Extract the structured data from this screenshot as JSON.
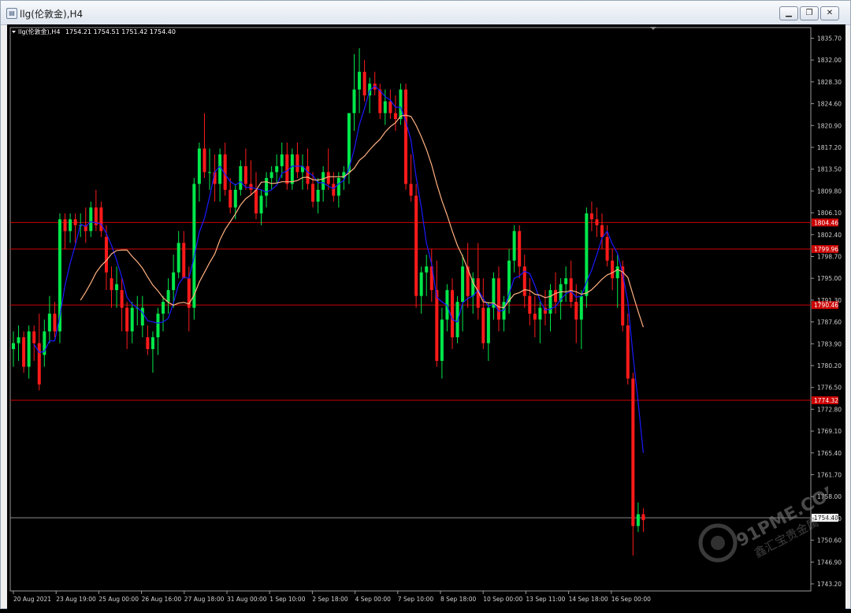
{
  "window": {
    "title": "llg(伦敦金),H4",
    "buttons": [
      "minimize",
      "restore",
      "close"
    ]
  },
  "chart_header": {
    "symbol": "llg(伦敦金),H4",
    "ohlc": "1754.21 1754.51 1751.42 1754.40"
  },
  "watermark": {
    "text_main": "91PME.COM",
    "text_sub": "鑫汇宝贵金属"
  },
  "colors": {
    "background": "#000000",
    "bull": "#00e84a",
    "bear": "#ff1a1a",
    "ma_fast": "#1a1aff",
    "ma_slow": "#ffb080",
    "level_line": "#cc0000",
    "current_line": "#8a8a8a"
  },
  "chart_data": {
    "type": "candlestick",
    "x_labels": [
      "20 Aug 2021",
      "23 Aug 19:00",
      "25 Aug 00:00",
      "26 Aug 16:00",
      "27 Aug 18:00",
      "31 Aug 00:00",
      "1 Sep 10:00",
      "2 Sep 18:00",
      "4 Sep 00:00",
      "7 Sep 10:00",
      "8 Sep 18:00",
      "10 Sep 00:00",
      "13 Sep 11:00",
      "14 Sep 18:00",
      "16 Sep 00:00"
    ],
    "x_label_candle_index": [
      0,
      7,
      14,
      21,
      28,
      35,
      42,
      49,
      56,
      63,
      70,
      77,
      84,
      91,
      98
    ],
    "y_ticks": [
      1835.7,
      1832.0,
      1828.3,
      1824.6,
      1820.9,
      1817.2,
      1813.5,
      1809.8,
      1806.1,
      1802.4,
      1798.7,
      1795.0,
      1791.3,
      1787.6,
      1783.9,
      1780.2,
      1776.5,
      1772.8,
      1769.1,
      1765.4,
      1761.7,
      1758.0,
      1754.3,
      1750.6,
      1746.9,
      1743.2
    ],
    "ylim": [
      1742.0,
      1837.5
    ],
    "horizontal_levels": [
      {
        "value": 1804.46,
        "label": "1804.46"
      },
      {
        "value": 1799.96,
        "label": "1799.96"
      },
      {
        "value": 1790.46,
        "label": "1790.46"
      },
      {
        "value": 1774.32,
        "label": "1774.32"
      }
    ],
    "current_price": {
      "value": 1754.4,
      "label": "1754.40"
    },
    "candles": [
      [
        1783,
        1786,
        1780,
        1784
      ],
      [
        1784,
        1787,
        1781,
        1785
      ],
      [
        1785,
        1786,
        1779,
        1780
      ],
      [
        1780,
        1787,
        1778,
        1786
      ],
      [
        1786,
        1787,
        1781,
        1784
      ],
      [
        1784,
        1789,
        1776,
        1777
      ],
      [
        1782,
        1788,
        1780,
        1786
      ],
      [
        1786,
        1792,
        1784,
        1789
      ],
      [
        1789,
        1791,
        1785,
        1786
      ],
      [
        1786,
        1806,
        1784,
        1805
      ],
      [
        1805,
        1806,
        1800,
        1803
      ],
      [
        1803,
        1806,
        1801,
        1805
      ],
      [
        1805,
        1806,
        1801,
        1804
      ],
      [
        1804,
        1806,
        1802,
        1804
      ],
      [
        1804,
        1807,
        1801,
        1803
      ],
      [
        1803,
        1808,
        1802,
        1807
      ],
      [
        1807,
        1810,
        1803,
        1804
      ],
      [
        1807,
        1808,
        1802,
        1803
      ],
      [
        1802,
        1804,
        1793,
        1796
      ],
      [
        1795,
        1797,
        1790,
        1793
      ],
      [
        1793,
        1797,
        1790,
        1794
      ],
      [
        1793,
        1795,
        1786,
        1790
      ],
      [
        1790,
        1791,
        1783,
        1786
      ],
      [
        1786,
        1791,
        1784,
        1790
      ],
      [
        1790,
        1792,
        1787,
        1790
      ],
      [
        1787,
        1792,
        1785,
        1790
      ],
      [
        1785,
        1787,
        1782,
        1783
      ],
      [
        1783,
        1786,
        1779,
        1785
      ],
      [
        1785,
        1790,
        1782,
        1789
      ],
      [
        1789,
        1792,
        1786,
        1791
      ],
      [
        1791,
        1795,
        1789,
        1793
      ],
      [
        1793,
        1799,
        1790,
        1796
      ],
      [
        1796,
        1803,
        1795,
        1801
      ],
      [
        1801,
        1803,
        1795,
        1795
      ],
      [
        1795,
        1797,
        1786,
        1790
      ],
      [
        1790,
        1812,
        1788,
        1811
      ],
      [
        1811,
        1818,
        1808,
        1817
      ],
      [
        1817,
        1823,
        1812,
        1813
      ],
      [
        1813,
        1817,
        1810,
        1813
      ],
      [
        1813,
        1816,
        1808,
        1811
      ],
      [
        1811,
        1817,
        1808,
        1816
      ],
      [
        1816,
        1818,
        1809,
        1810
      ],
      [
        1810,
        1812,
        1806,
        1807
      ],
      [
        1807,
        1811,
        1805,
        1810
      ],
      [
        1810,
        1815,
        1809,
        1814
      ],
      [
        1814,
        1817,
        1810,
        1811
      ],
      [
        1811,
        1815,
        1809,
        1810
      ],
      [
        1810,
        1813,
        1805,
        1806
      ],
      [
        1806,
        1810,
        1804,
        1809
      ],
      [
        1809,
        1813,
        1807,
        1812
      ],
      [
        1812,
        1814,
        1810,
        1813
      ],
      [
        1813,
        1816,
        1811,
        1814
      ],
      [
        1814,
        1818,
        1812,
        1816
      ],
      [
        1816,
        1818,
        1810,
        1811
      ],
      [
        1811,
        1817,
        1810,
        1816
      ],
      [
        1816,
        1818,
        1812,
        1813
      ],
      [
        1813,
        1816,
        1810,
        1814
      ],
      [
        1814,
        1817,
        1810,
        1811
      ],
      [
        1811,
        1813,
        1807,
        1808
      ],
      [
        1808,
        1812,
        1806,
        1810
      ],
      [
        1810,
        1814,
        1808,
        1813
      ],
      [
        1813,
        1817,
        1810,
        1811
      ],
      [
        1811,
        1813,
        1808,
        1809
      ],
      [
        1809,
        1813,
        1807,
        1812
      ],
      [
        1812,
        1814,
        1810,
        1813
      ],
      [
        1813,
        1823,
        1811,
        1823
      ],
      [
        1823,
        1833,
        1820,
        1827
      ],
      [
        1827,
        1834,
        1823,
        1830
      ],
      [
        1830,
        1832,
        1825,
        1826
      ],
      [
        1826,
        1829,
        1823,
        1828
      ],
      [
        1828,
        1830,
        1826,
        1827
      ],
      [
        1827,
        1828,
        1822,
        1823
      ],
      [
        1823,
        1827,
        1821,
        1825
      ],
      [
        1825,
        1827,
        1822,
        1823
      ],
      [
        1823,
        1826,
        1820,
        1822
      ],
      [
        1822,
        1828,
        1821,
        1827
      ],
      [
        1827,
        1828,
        1810,
        1811
      ],
      [
        1811,
        1816,
        1808,
        1809
      ],
      [
        1809,
        1811,
        1790,
        1792
      ],
      [
        1792,
        1797,
        1789,
        1796
      ],
      [
        1796,
        1799,
        1792,
        1797
      ],
      [
        1797,
        1800,
        1791,
        1793
      ]
    ],
    "ma_fast": [],
    "ma_slow": []
  }
}
